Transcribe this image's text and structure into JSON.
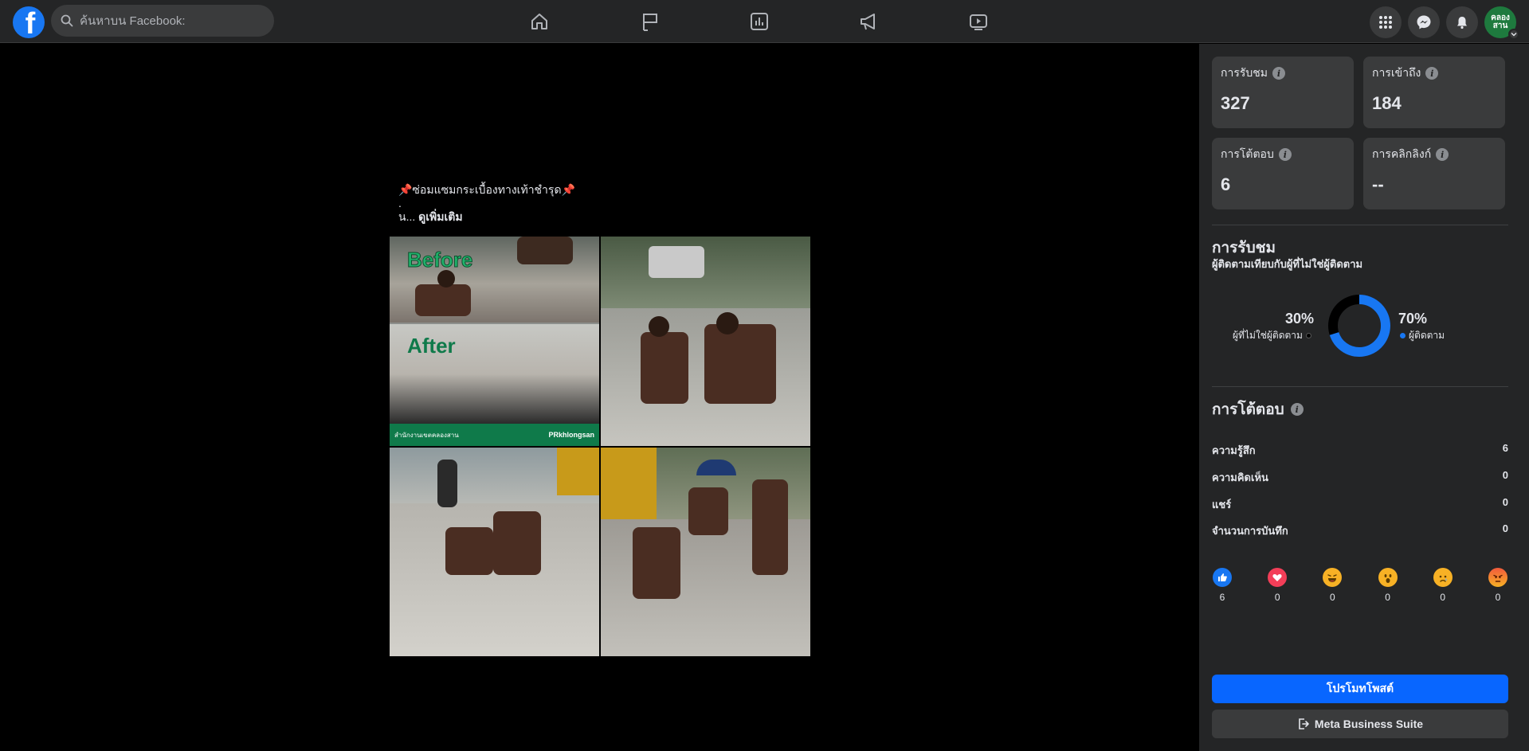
{
  "search": {
    "placeholder": "ค้นหาบน Facebook:"
  },
  "nav": [
    "home-icon",
    "flag-icon",
    "insights-icon",
    "megaphone-icon",
    "video-icon"
  ],
  "header_right": {
    "avatar_text": "คลอง สาน"
  },
  "post": {
    "caption_line1": "📌ซ่อมแซมกระเบื้องทางเท้าชำรุด📌",
    "caption_line2": ".",
    "caption_prefix": "น... ",
    "see_more": "ดูเพิ่มเติม",
    "before_label": "Before",
    "after_label": "After",
    "banner_left": "สำนักงานเขตคลองสาน",
    "banner_right": "PRkhlongsan"
  },
  "stats": [
    {
      "label": "การรับชม",
      "value": "327"
    },
    {
      "label": "การเข้าถึง",
      "value": "184"
    },
    {
      "label": "การโต้ตอบ",
      "value": "6"
    },
    {
      "label": "การคลิกลิงก์",
      "value": "--"
    }
  ],
  "views": {
    "title": "การรับชม",
    "subtitle": "ผู้ติดตามเทียบกับผู้ที่ไม่ใช่ผู้ติดตาม",
    "non_followers_pct": "30%",
    "non_followers_label": "ผู้ที่ไม่ใช่ผู้ติดตาม",
    "followers_pct": "70%",
    "followers_label": "ผู้ติดตาม",
    "followers_fraction": 0.7,
    "followers_color": "#1877f2",
    "non_followers_color": "#000000"
  },
  "interactions": {
    "title": "การโต้ตอบ",
    "rows": [
      {
        "label": "ความรู้สึก",
        "value": "6"
      },
      {
        "label": "ความคิดเห็น",
        "value": "0"
      },
      {
        "label": "แชร์",
        "value": "0"
      },
      {
        "label": "จำนวนการบันทึก",
        "value": "0"
      }
    ],
    "reactions": [
      {
        "icon": "like-icon",
        "count": "6"
      },
      {
        "icon": "love-icon",
        "count": "0"
      },
      {
        "icon": "haha-icon",
        "count": "0"
      },
      {
        "icon": "wow-icon",
        "count": "0"
      },
      {
        "icon": "sad-icon",
        "count": "0"
      },
      {
        "icon": "angry-icon",
        "count": "0"
      }
    ]
  },
  "buttons": {
    "promote": "โปรโมทโพสต์",
    "business_suite": "Meta Business Suite"
  }
}
